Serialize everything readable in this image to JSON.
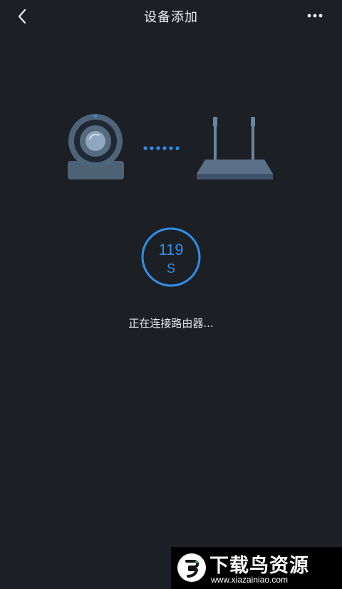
{
  "header": {
    "title": "设备添加",
    "back_icon": "chevron-left-icon",
    "more_icon": "more-horizontal-icon"
  },
  "illustration": {
    "camera_icon": "camera-icon",
    "connection_icon": "dotted-connection-icon",
    "router_icon": "router-icon"
  },
  "countdown": {
    "value": "119",
    "unit": "S",
    "progress": 0.99
  },
  "status": {
    "text": "正在连接路由器..."
  },
  "watermark": {
    "title": "下载鸟资源",
    "url": "www.xiazainiao.com"
  },
  "colors": {
    "background": "#1c1f24",
    "accent": "#2f8fe6",
    "device": "#4f6477"
  }
}
